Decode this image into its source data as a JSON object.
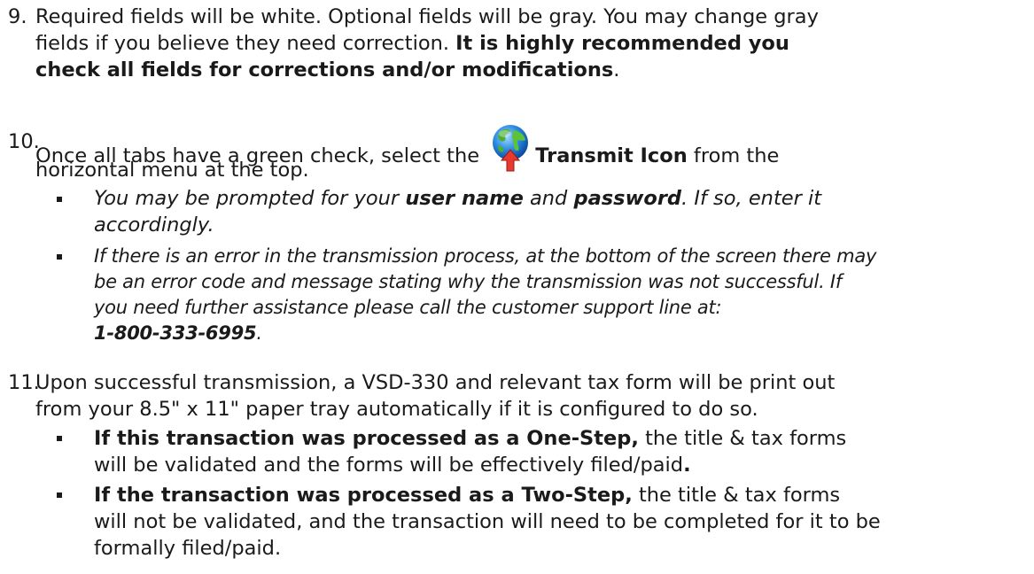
{
  "step9": {
    "number": "9.",
    "line1": "Required fields will be white.  Optional fields will be gray.  You may change gray",
    "line2": "fields if you believe they need correction.  ",
    "bold": "It is highly recommended you",
    "bold2": "check all fields for corrections and/or modifications",
    "end": "."
  },
  "step10": {
    "number": "10.",
    "pre": "Once all tabs have a green check, select the ",
    "icon_name": "transmit-icon",
    "icon_label": "Transmit Icon",
    "post": " from the",
    "line2": "horizontal menu at the top.",
    "bullet1": {
      "pre": "You may be prompted for your ",
      "b1": "user name",
      "mid": " and ",
      "b2": "password",
      "post": ". If so, enter it",
      "line2": "accordingly."
    },
    "bullet2": {
      "line1": "If there is an error in the transmission process, at the bottom of the screen there may",
      "line2": "be an error code and message stating why the transmission was not successful.  If",
      "line3": "you need further assistance please call the customer support line at:",
      "phone": "1-800-333-6995",
      "end": "."
    }
  },
  "step11": {
    "number": "11.",
    "line1": "Upon successful transmission, a VSD-330 and relevant tax form will be print out",
    "line2": "from your 8.5\" x 11\" paper tray automatically if it is configured to do so.",
    "bullet1": {
      "bold": "If this transaction was processed as a One-Step,",
      "post": " the title & tax forms",
      "line2": "will be validated and the forms will be effectively filed/paid",
      "end": "."
    },
    "bullet2": {
      "bold": "If the transaction was processed as a Two-Step,",
      "post": " the title & tax forms",
      "line2": "will not be validated, and the transaction will need to be completed for it to be",
      "line3": "formally filed/paid."
    }
  }
}
